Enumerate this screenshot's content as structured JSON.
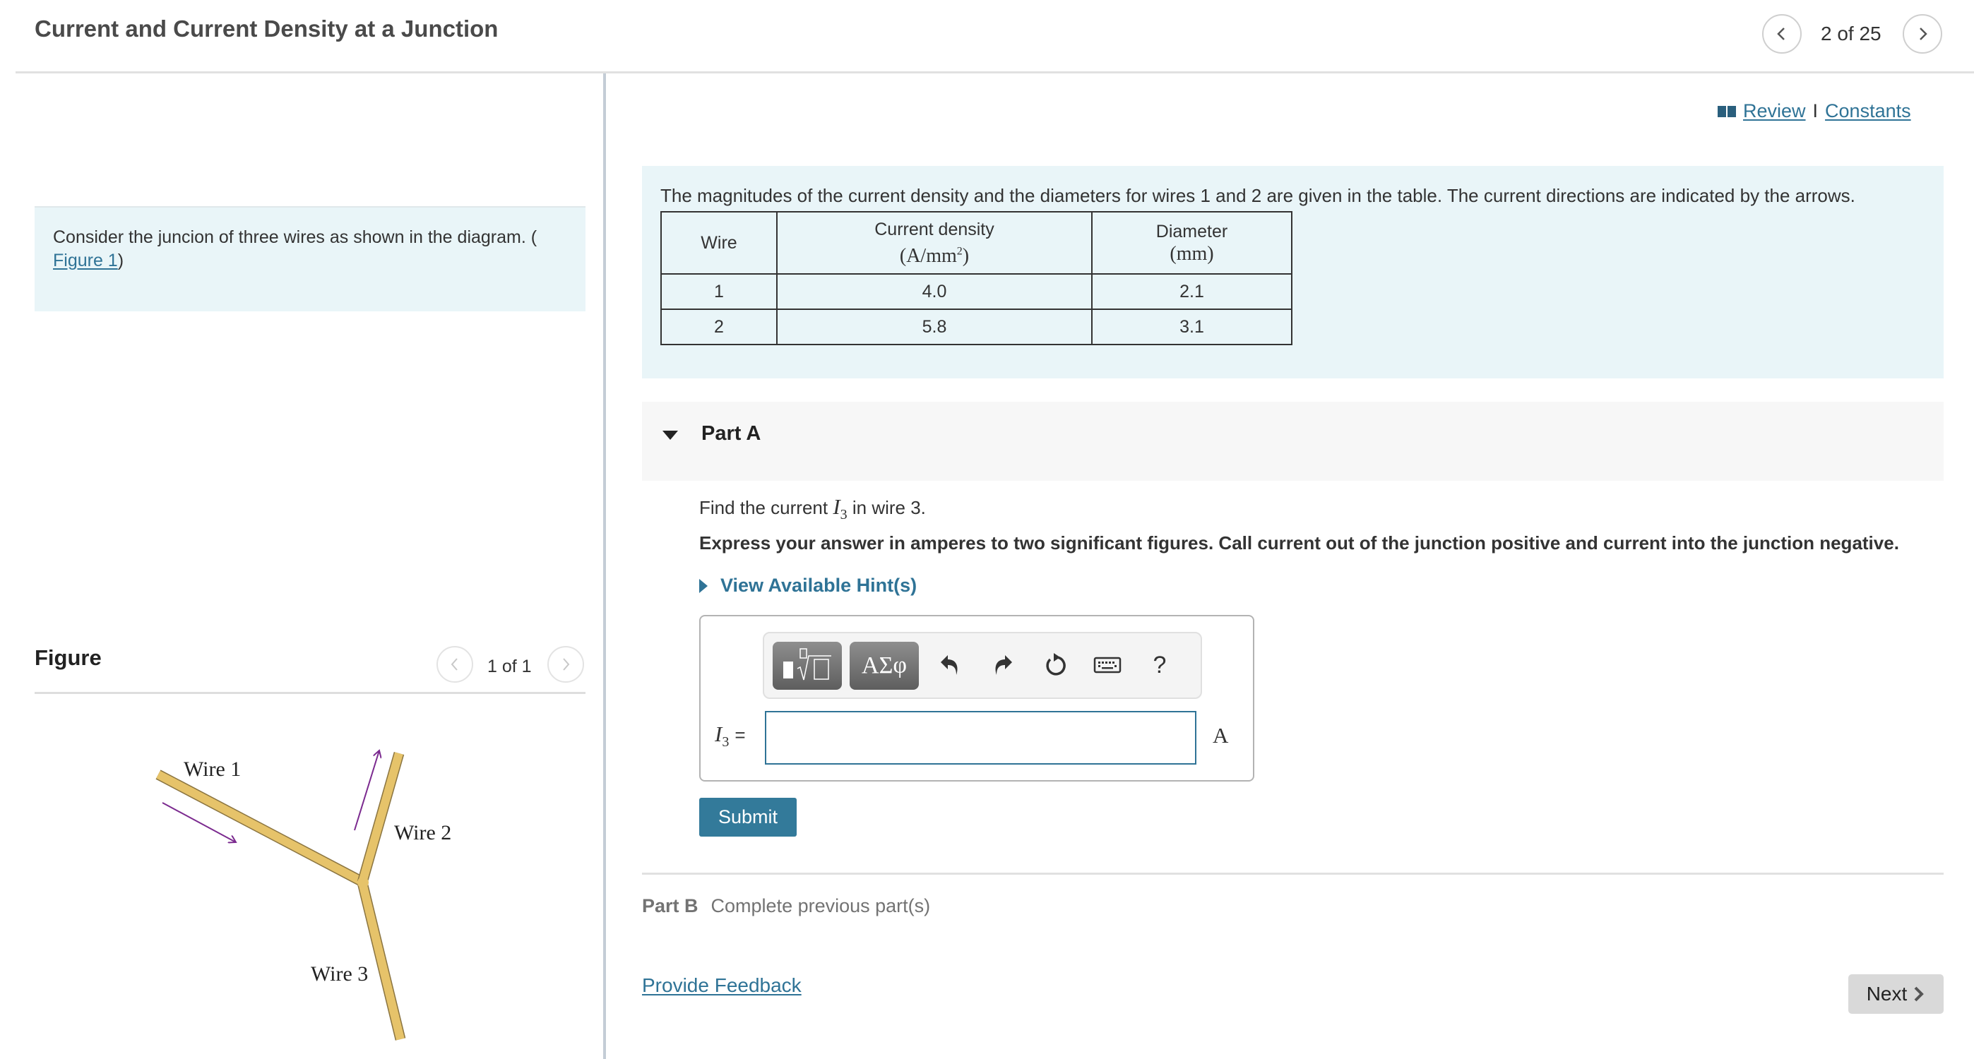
{
  "header": {
    "title": "Current and Current Density at a Junction",
    "page_count": "2 of 25",
    "prev_icon": "chevron-left-icon",
    "next_icon": "chevron-right-icon"
  },
  "left_pane": {
    "intro_text": "Consider the juncion of three wires as shown in the diagram. (",
    "intro_link": "Figure 1",
    "intro_close": ")",
    "figure_label": "Figure",
    "figure_count": "1 of 1",
    "figure": {
      "labels": [
        "Wire 1",
        "Wire 2",
        "Wire 3"
      ],
      "wire_color": "#e6c36a",
      "arrow_color": "#7b2a8f"
    }
  },
  "right_pane": {
    "links": {
      "review": "Review",
      "separator": "I",
      "constants": "Constants",
      "icon": "book-icon"
    },
    "info_text": "The magnitudes of the current density and the diameters for wires 1 and 2 are given in the table. The current directions are indicated by the arrows.",
    "table": {
      "headers": [
        {
          "title": "Wire",
          "unit": ""
        },
        {
          "title": "Current density",
          "unit": "(A/mm",
          "unit_sup": "2",
          "unit_close": ")"
        },
        {
          "title": "Diameter",
          "unit": "(mm)"
        }
      ],
      "rows": [
        [
          "1",
          "4.0",
          "2.1"
        ],
        [
          "2",
          "5.8",
          "3.1"
        ]
      ]
    },
    "part_a": {
      "title": "Part A",
      "find_prefix": "Find the current ",
      "find_var": "I",
      "find_sub": "3",
      "find_suffix": " in wire 3.",
      "instructions": "Express your answer in amperes to two significant figures. Call current out of the junction positive and current into the junction negative.",
      "hint_label": "View Available Hint(s)",
      "toolbar": {
        "templates_icon": "templates-sqrt-icon",
        "symbols_label": "ΑΣφ",
        "undo_icon": "undo-icon",
        "redo_icon": "redo-icon",
        "reset_icon": "reset-icon",
        "keyboard_icon": "keyboard-icon",
        "help_label": "?"
      },
      "answer_var": "I",
      "answer_sub": "3",
      "answer_eq": "=",
      "answer_value": "",
      "answer_unit": "A",
      "submit_label": "Submit"
    },
    "part_b": {
      "title": "Part B",
      "status": "Complete previous part(s)"
    },
    "feedback_label": "Provide Feedback",
    "next_label": "Next"
  },
  "colors": {
    "accent": "#2f7396",
    "submit": "#337a9a",
    "info_bg": "#e9f5f8",
    "part_header_bg": "#f7f7f7"
  }
}
